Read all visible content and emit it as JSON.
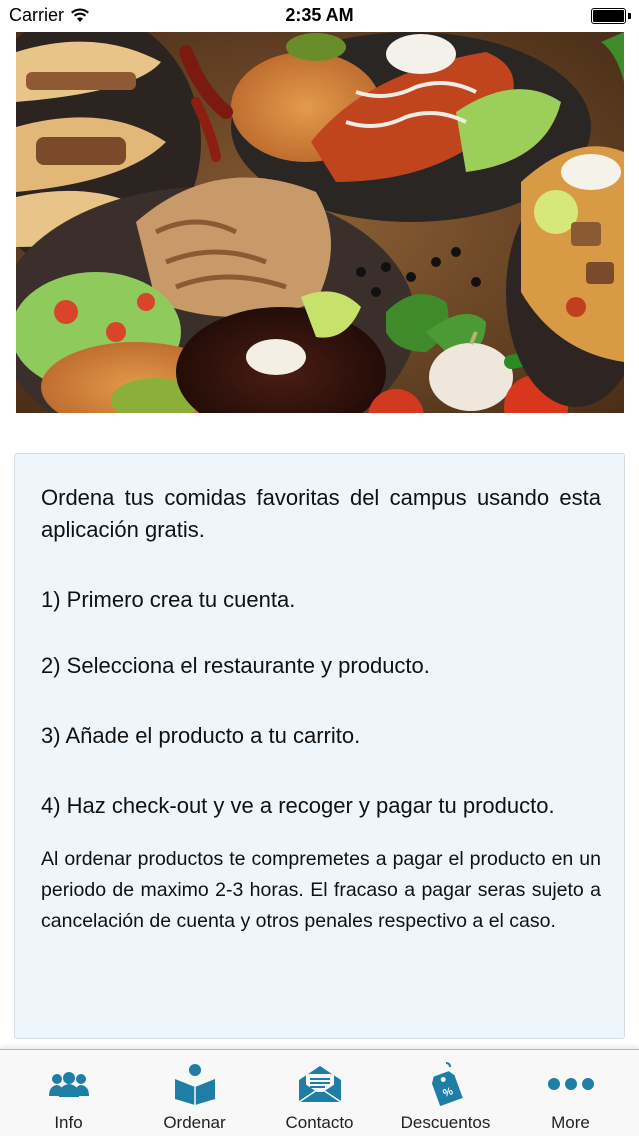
{
  "status_bar": {
    "carrier": "Carrier",
    "time": "2:35 AM"
  },
  "info": {
    "intro": "Ordena tus comidas favoritas del campus usando esta aplicación gratis.",
    "step1": "1) Primero crea tu cuenta.",
    "step2": "2)  Selecciona el restaurante y producto.",
    "step3": "3) Añade el producto a tu carrito.",
    "step4": "4) Haz check-out y ve a recoger y pagar  tu producto.",
    "terms": "Al ordenar productos te compremetes a pagar el producto en un periodo de maximo 2-3 horas. El fracaso a pagar seras sujeto a cancelación de cuenta y otros penales respectivo a el caso."
  },
  "tabs": [
    {
      "label": "Info",
      "icon": "people-icon"
    },
    {
      "label": "Ordenar",
      "icon": "order-person-icon"
    },
    {
      "label": "Contacto",
      "icon": "envelope-icon"
    },
    {
      "label": "Descuentos",
      "icon": "discount-tag-icon"
    },
    {
      "label": "More",
      "icon": "more-dots-icon"
    }
  ],
  "colors": {
    "tab_icon": "#1f7ea5",
    "card_background": "#eef5fb"
  }
}
